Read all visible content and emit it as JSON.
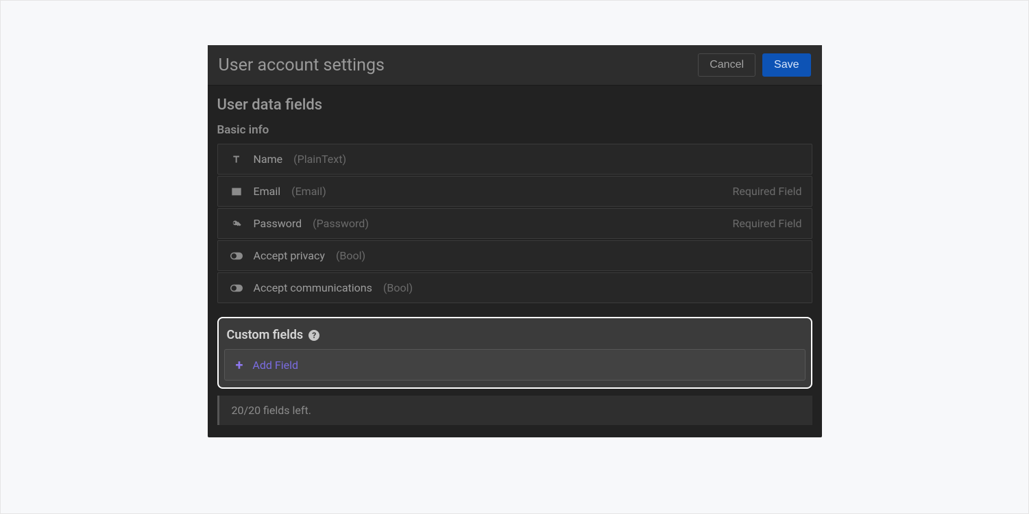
{
  "header": {
    "title": "User account settings",
    "cancel": "Cancel",
    "save": "Save"
  },
  "section_title": "User data fields",
  "basic_info": {
    "title": "Basic info",
    "fields": [
      {
        "name": "Name",
        "type": "(PlainText)",
        "required": ""
      },
      {
        "name": "Email",
        "type": "(Email)",
        "required": "Required Field"
      },
      {
        "name": "Password",
        "type": "(Password)",
        "required": "Required Field"
      },
      {
        "name": "Accept privacy",
        "type": "(Bool)",
        "required": ""
      },
      {
        "name": "Accept communications",
        "type": "(Bool)",
        "required": ""
      }
    ]
  },
  "custom": {
    "title": "Custom fields",
    "add_label": "Add Field"
  },
  "fields_left": "20/20 fields left."
}
